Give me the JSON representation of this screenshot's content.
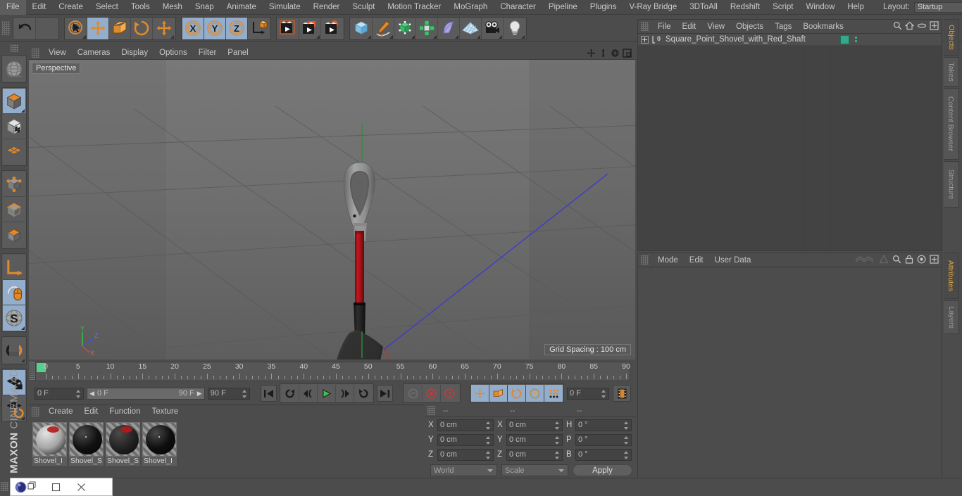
{
  "app": {
    "brand_maxon": "MAXON",
    "brand_product": "CINEMA 4D"
  },
  "menubar": {
    "items": [
      "File",
      "Edit",
      "Create",
      "Select",
      "Tools",
      "Mesh",
      "Snap",
      "Animate",
      "Simulate",
      "Render",
      "Sculpt",
      "Motion Tracker",
      "MoGraph",
      "Character",
      "Pipeline",
      "Plugins",
      "V-Ray Bridge",
      "3DToAll",
      "Redshift",
      "Script",
      "Window",
      "Help"
    ],
    "layout_label": "Layout:",
    "layout_value": "Startup",
    "search_icon": "search-icon"
  },
  "toolbar": {
    "groups": [
      {
        "name": "history",
        "buttons": [
          {
            "icon": "undo-icon",
            "label": "Undo",
            "selected": false,
            "dim": false,
            "corner": false
          },
          {
            "icon": "redo-icon",
            "label": "Redo",
            "selected": false,
            "dim": true,
            "corner": false
          }
        ]
      },
      {
        "name": "tools",
        "buttons": [
          {
            "icon": "live-selection-icon",
            "label": "Live Selection",
            "selected": false,
            "dim": false,
            "corner": true
          },
          {
            "icon": "move-icon",
            "label": "Move",
            "selected": true,
            "dim": false,
            "corner": false
          },
          {
            "icon": "scale-icon",
            "label": "Scale",
            "selected": false,
            "dim": false,
            "corner": false
          },
          {
            "icon": "rotate-icon",
            "label": "Rotate",
            "selected": false,
            "dim": false,
            "corner": false
          },
          {
            "icon": "move-alt-icon",
            "label": "Move Tool",
            "selected": false,
            "dim": false,
            "corner": true
          }
        ]
      },
      {
        "name": "axis-locks",
        "buttons": [
          {
            "icon": "x-axis-icon",
            "label": "X Axis",
            "selected": true,
            "dim": false,
            "corner": false
          },
          {
            "icon": "y-axis-icon",
            "label": "Y Axis",
            "selected": true,
            "dim": false,
            "corner": false
          },
          {
            "icon": "z-axis-icon",
            "label": "Z Axis",
            "selected": true,
            "dim": false,
            "corner": false
          },
          {
            "icon": "world-coordinates-icon",
            "label": "World / Object Coordinate System",
            "selected": false,
            "dim": false,
            "corner": false
          }
        ]
      },
      {
        "name": "render",
        "buttons": [
          {
            "icon": "render-view-icon",
            "label": "Render View",
            "selected": false,
            "dim": false,
            "corner": false
          },
          {
            "icon": "render-region-icon",
            "label": "Render to Picture Viewer",
            "selected": false,
            "dim": false,
            "corner": true
          },
          {
            "icon": "render-settings-icon",
            "label": "Edit Render Settings",
            "selected": false,
            "dim": false,
            "corner": false
          }
        ]
      },
      {
        "name": "create",
        "buttons": [
          {
            "icon": "cube-primitive-icon",
            "label": "Cube",
            "selected": false,
            "dim": false,
            "corner": true
          },
          {
            "icon": "spline-pen-icon",
            "label": "Pen / Splines",
            "selected": false,
            "dim": false,
            "corner": true
          },
          {
            "icon": "generator-icon",
            "label": "Subdivision Surface",
            "selected": false,
            "dim": false,
            "corner": true
          },
          {
            "icon": "mograph-icon",
            "label": "MoGraph",
            "selected": false,
            "dim": false,
            "corner": true
          },
          {
            "icon": "deformer-icon",
            "label": "Bend Deformer",
            "selected": false,
            "dim": false,
            "corner": true
          },
          {
            "icon": "environment-icon",
            "label": "Floor / Environment",
            "selected": false,
            "dim": false,
            "corner": true
          },
          {
            "icon": "camera-icon",
            "label": "Camera",
            "selected": false,
            "dim": false,
            "corner": true
          },
          {
            "icon": "light-icon",
            "label": "Light",
            "selected": false,
            "dim": false,
            "corner": true
          }
        ]
      }
    ]
  },
  "left_toolbar": {
    "groups": [
      {
        "name": "axis",
        "buttons": [
          {
            "icon": "world-axis-icon",
            "label": "Make Editable / World Axis",
            "selected": false,
            "corner": false
          }
        ]
      },
      {
        "name": "modes",
        "buttons": [
          {
            "icon": "model-mode-icon",
            "label": "Model Mode",
            "selected": true,
            "corner": true
          },
          {
            "icon": "texture-mode-icon",
            "label": "Texture Mode",
            "selected": false,
            "corner": false
          },
          {
            "icon": "workplane-mode-icon",
            "label": "Workplane Mode",
            "selected": false,
            "corner": false
          }
        ]
      },
      {
        "name": "components",
        "buttons": [
          {
            "icon": "points-mode-icon",
            "label": "Points Mode",
            "selected": false,
            "corner": false
          },
          {
            "icon": "edges-mode-icon",
            "label": "Edges Mode",
            "selected": false,
            "corner": false
          },
          {
            "icon": "polygons-mode-icon",
            "label": "Polygons Mode",
            "selected": false,
            "corner": false
          }
        ]
      },
      {
        "name": "axis-tools",
        "buttons": [
          {
            "icon": "enable-axis-icon",
            "label": "Enable Axis Modification",
            "selected": false,
            "corner": false
          },
          {
            "icon": "viewport-solo-icon",
            "label": "Viewport Solo Single",
            "selected": true,
            "corner": false
          },
          {
            "icon": "soft-selection-icon",
            "label": "Soft Selection",
            "selected": true,
            "corner": true
          }
        ]
      },
      {
        "name": "snap",
        "buttons": [
          {
            "icon": "snap-magnet-icon",
            "label": "Enable Snapping",
            "selected": false,
            "corner": true
          }
        ]
      },
      {
        "name": "workplane",
        "buttons": [
          {
            "icon": "workplane-lock-icon",
            "label": "Lock Workplane",
            "selected": true,
            "corner": false
          },
          {
            "icon": "workplane-rotate-icon",
            "label": "Planar Workplane Rotation",
            "selected": false,
            "corner": true
          }
        ]
      }
    ]
  },
  "viewport": {
    "menu": [
      "View",
      "Cameras",
      "Display",
      "Options",
      "Filter",
      "Panel"
    ],
    "nav_icons": [
      "pan-icon",
      "dolly-icon",
      "orbit-icon",
      "maximize-viewport-icon"
    ],
    "label": "Perspective",
    "grid_spacing": "Grid Spacing : 100 cm",
    "axis_gizmo": {
      "y": "Y",
      "z": "Z",
      "x": "X"
    },
    "model": {
      "name": "Square Point Shovel with Red Shaft",
      "handle_color": "#8e8e8e",
      "shaft_color": "#b01217",
      "ferrule_color": "#1f1f1f",
      "blade_color": "#2e2e2e"
    }
  },
  "timeline": {
    "tick_labels": [
      "0",
      "5",
      "10",
      "15",
      "20",
      "25",
      "30",
      "35",
      "40",
      "45",
      "50",
      "55",
      "60",
      "65",
      "70",
      "75",
      "80",
      "85",
      "90"
    ],
    "current_frame_marker": "0",
    "current_frame": "0 F",
    "range_start": "0 F",
    "range_end": "90 F",
    "end_frame": "90 F",
    "frame_field_right": "0 F",
    "transport": [
      {
        "icon": "go-to-start-icon",
        "label": "Go to Start"
      },
      {
        "icon": "play-backwards-icon",
        "label": "Play Backwards"
      },
      {
        "icon": "step-back-icon",
        "label": "Go to Previous Frame"
      },
      {
        "icon": "play-forward-icon",
        "label": "Play Forwards"
      },
      {
        "icon": "step-forward-icon",
        "label": "Go to Next Frame"
      },
      {
        "icon": "play-loop-icon",
        "label": "Play Forward"
      },
      {
        "icon": "go-to-end-icon",
        "label": "Go to End"
      }
    ],
    "key_buttons": [
      {
        "icon": "autokey-icon",
        "label": "Autokeying",
        "selected": false,
        "dim": true
      },
      {
        "icon": "record-key-icon",
        "label": "Record Active Objects",
        "selected": false,
        "dim": false
      },
      {
        "icon": "keyframe-selection-icon",
        "label": "Keyframe Selection",
        "selected": false,
        "dim": false
      }
    ],
    "param_buttons": [
      {
        "icon": "key-position-icon",
        "label": "Position",
        "selected": true
      },
      {
        "icon": "key-scale-icon",
        "label": "Scale",
        "selected": true
      },
      {
        "icon": "key-rotation-icon",
        "label": "Rotation",
        "selected": true
      },
      {
        "icon": "key-pla-icon",
        "label": "Point Level Animation",
        "selected": true
      },
      {
        "icon": "key-parameter-icon",
        "label": "Parameter",
        "selected": true
      }
    ],
    "filmstrip_button": {
      "icon": "timeline-filmstrip-icon",
      "label": "Animation Mode",
      "selected": true
    }
  },
  "materials": {
    "menu": [
      "Create",
      "Edit",
      "Function",
      "Texture"
    ],
    "items": [
      {
        "name": "Shovel_I",
        "ball_color": "#a6a6a6",
        "has_red": true
      },
      {
        "name": "Shovel_S",
        "ball_color": "#111111",
        "has_red": false
      },
      {
        "name": "Shovel_S",
        "ball_color": "#232323",
        "has_red": true
      },
      {
        "name": "Shovel_I",
        "ball_color": "#0e0e0e",
        "has_red": false
      }
    ]
  },
  "coordinates": {
    "headers": [
      "--",
      "--",
      "--"
    ],
    "rows": [
      {
        "axis": "X",
        "position": "0 cm",
        "axis2": "X",
        "size": "0 cm",
        "axis3": "H",
        "rotation": "0 °"
      },
      {
        "axis": "Y",
        "position": "0 cm",
        "axis2": "Y",
        "size": "0 cm",
        "axis3": "P",
        "rotation": "0 °"
      },
      {
        "axis": "Z",
        "position": "0 cm",
        "axis2": "Z",
        "size": "0 cm",
        "axis3": "B",
        "rotation": "0 °"
      }
    ],
    "system": "World",
    "mode": "Scale",
    "apply_label": "Apply"
  },
  "objects": {
    "menu": [
      "File",
      "Edit",
      "View",
      "Objects",
      "Tags",
      "Bookmarks"
    ],
    "tools": [
      "search-icon",
      "home-icon",
      "link-icon",
      "new-layer-icon"
    ],
    "rows": [
      {
        "name": "Square_Point_Shovel_with_Red_Shaft",
        "layer_color": "#35a88a",
        "expandable": true
      }
    ]
  },
  "attributes": {
    "menu": [
      "Mode",
      "Edit",
      "User Data"
    ],
    "tools": [
      "wave-icon",
      "cone-icon",
      "search-icon",
      "lock-icon",
      "target-icon",
      "new-tab-icon"
    ]
  },
  "right_tabs_top": [
    {
      "label": "Objects",
      "active": true
    },
    {
      "label": "Takes",
      "active": false
    },
    {
      "label": "Content Browser",
      "active": false
    },
    {
      "label": "Structure",
      "active": false
    }
  ],
  "right_tabs_bottom": [
    {
      "label": "Attributes",
      "active": true
    },
    {
      "label": "Layers",
      "active": false
    }
  ],
  "taskbar_window": {
    "app_icon": "cinema4d-logo-icon",
    "restore_icon": "restore-window-icon",
    "maximize_icon": "maximize-window-icon",
    "close_icon": "close-window-icon"
  }
}
